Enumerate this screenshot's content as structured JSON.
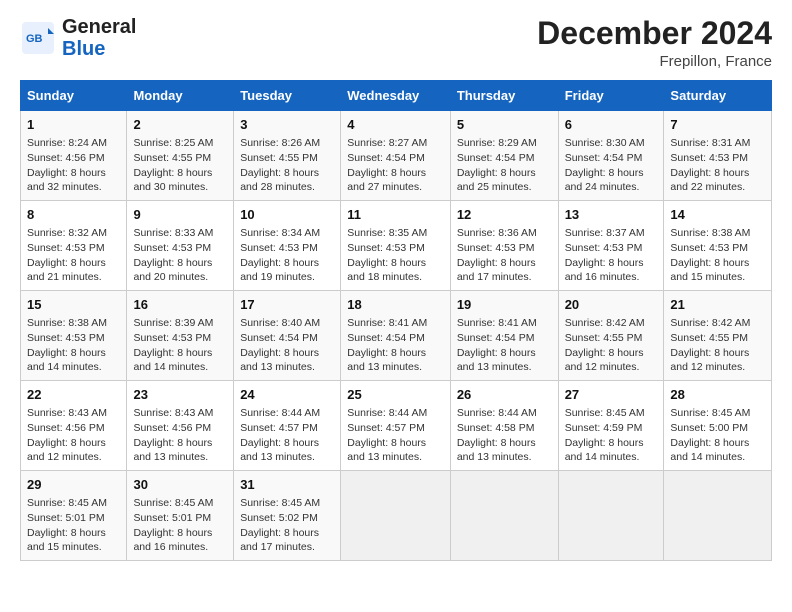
{
  "header": {
    "logo_general": "General",
    "logo_blue": "Blue",
    "month": "December 2024",
    "location": "Frepillon, France"
  },
  "days_of_week": [
    "Sunday",
    "Monday",
    "Tuesday",
    "Wednesday",
    "Thursday",
    "Friday",
    "Saturday"
  ],
  "weeks": [
    [
      {
        "day": 1,
        "sunrise": "8:24 AM",
        "sunset": "4:56 PM",
        "daylight": "8 hours and 32 minutes"
      },
      {
        "day": 2,
        "sunrise": "8:25 AM",
        "sunset": "4:55 PM",
        "daylight": "8 hours and 30 minutes"
      },
      {
        "day": 3,
        "sunrise": "8:26 AM",
        "sunset": "4:55 PM",
        "daylight": "8 hours and 28 minutes"
      },
      {
        "day": 4,
        "sunrise": "8:27 AM",
        "sunset": "4:54 PM",
        "daylight": "8 hours and 27 minutes"
      },
      {
        "day": 5,
        "sunrise": "8:29 AM",
        "sunset": "4:54 PM",
        "daylight": "8 hours and 25 minutes"
      },
      {
        "day": 6,
        "sunrise": "8:30 AM",
        "sunset": "4:54 PM",
        "daylight": "8 hours and 24 minutes"
      },
      {
        "day": 7,
        "sunrise": "8:31 AM",
        "sunset": "4:53 PM",
        "daylight": "8 hours and 22 minutes"
      }
    ],
    [
      {
        "day": 8,
        "sunrise": "8:32 AM",
        "sunset": "4:53 PM",
        "daylight": "8 hours and 21 minutes"
      },
      {
        "day": 9,
        "sunrise": "8:33 AM",
        "sunset": "4:53 PM",
        "daylight": "8 hours and 20 minutes"
      },
      {
        "day": 10,
        "sunrise": "8:34 AM",
        "sunset": "4:53 PM",
        "daylight": "8 hours and 19 minutes"
      },
      {
        "day": 11,
        "sunrise": "8:35 AM",
        "sunset": "4:53 PM",
        "daylight": "8 hours and 18 minutes"
      },
      {
        "day": 12,
        "sunrise": "8:36 AM",
        "sunset": "4:53 PM",
        "daylight": "8 hours and 17 minutes"
      },
      {
        "day": 13,
        "sunrise": "8:37 AM",
        "sunset": "4:53 PM",
        "daylight": "8 hours and 16 minutes"
      },
      {
        "day": 14,
        "sunrise": "8:38 AM",
        "sunset": "4:53 PM",
        "daylight": "8 hours and 15 minutes"
      }
    ],
    [
      {
        "day": 15,
        "sunrise": "8:38 AM",
        "sunset": "4:53 PM",
        "daylight": "8 hours and 14 minutes"
      },
      {
        "day": 16,
        "sunrise": "8:39 AM",
        "sunset": "4:53 PM",
        "daylight": "8 hours and 14 minutes"
      },
      {
        "day": 17,
        "sunrise": "8:40 AM",
        "sunset": "4:54 PM",
        "daylight": "8 hours and 13 minutes"
      },
      {
        "day": 18,
        "sunrise": "8:41 AM",
        "sunset": "4:54 PM",
        "daylight": "8 hours and 13 minutes"
      },
      {
        "day": 19,
        "sunrise": "8:41 AM",
        "sunset": "4:54 PM",
        "daylight": "8 hours and 13 minutes"
      },
      {
        "day": 20,
        "sunrise": "8:42 AM",
        "sunset": "4:55 PM",
        "daylight": "8 hours and 12 minutes"
      },
      {
        "day": 21,
        "sunrise": "8:42 AM",
        "sunset": "4:55 PM",
        "daylight": "8 hours and 12 minutes"
      }
    ],
    [
      {
        "day": 22,
        "sunrise": "8:43 AM",
        "sunset": "4:56 PM",
        "daylight": "8 hours and 12 minutes"
      },
      {
        "day": 23,
        "sunrise": "8:43 AM",
        "sunset": "4:56 PM",
        "daylight": "8 hours and 13 minutes"
      },
      {
        "day": 24,
        "sunrise": "8:44 AM",
        "sunset": "4:57 PM",
        "daylight": "8 hours and 13 minutes"
      },
      {
        "day": 25,
        "sunrise": "8:44 AM",
        "sunset": "4:57 PM",
        "daylight": "8 hours and 13 minutes"
      },
      {
        "day": 26,
        "sunrise": "8:44 AM",
        "sunset": "4:58 PM",
        "daylight": "8 hours and 13 minutes"
      },
      {
        "day": 27,
        "sunrise": "8:45 AM",
        "sunset": "4:59 PM",
        "daylight": "8 hours and 14 minutes"
      },
      {
        "day": 28,
        "sunrise": "8:45 AM",
        "sunset": "5:00 PM",
        "daylight": "8 hours and 14 minutes"
      }
    ],
    [
      {
        "day": 29,
        "sunrise": "8:45 AM",
        "sunset": "5:01 PM",
        "daylight": "8 hours and 15 minutes"
      },
      {
        "day": 30,
        "sunrise": "8:45 AM",
        "sunset": "5:01 PM",
        "daylight": "8 hours and 16 minutes"
      },
      {
        "day": 31,
        "sunrise": "8:45 AM",
        "sunset": "5:02 PM",
        "daylight": "8 hours and 17 minutes"
      },
      null,
      null,
      null,
      null
    ]
  ]
}
